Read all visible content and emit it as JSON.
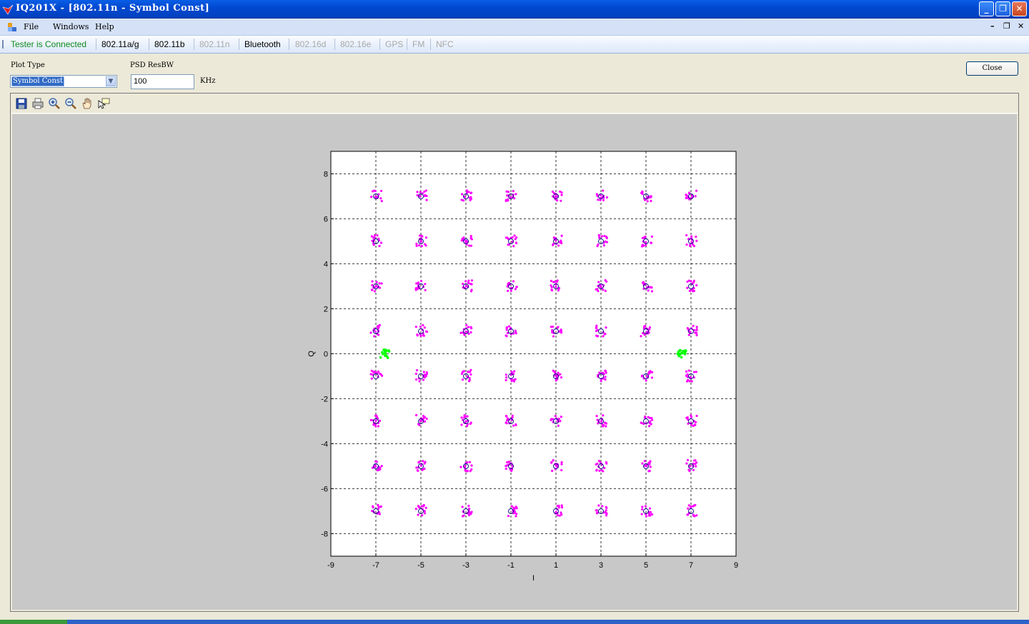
{
  "window": {
    "title": "IQ201X - [802.11n - Symbol Const]",
    "buttons": {
      "minimize": "_",
      "restore": "❐",
      "close": "✕"
    }
  },
  "menu": {
    "items": [
      "File",
      "Windows",
      "Help"
    ],
    "mdi": {
      "minimize": "–",
      "restore": "❐",
      "close": "✕"
    }
  },
  "tabs": [
    {
      "label": "Tester is Connected",
      "state": "status"
    },
    {
      "label": "802.11a/g",
      "state": "enabled"
    },
    {
      "label": "802.11b",
      "state": "enabled"
    },
    {
      "label": "802.11n",
      "state": "disabled"
    },
    {
      "label": "Bluetooth",
      "state": "enabled"
    },
    {
      "label": "802.16d",
      "state": "disabled"
    },
    {
      "label": "802.16e",
      "state": "disabled"
    },
    {
      "label": "GPS",
      "state": "disabled"
    },
    {
      "label": "FM",
      "state": "disabled"
    },
    {
      "label": "NFC",
      "state": "disabled"
    }
  ],
  "controls": {
    "plot_type_label": "Plot Type",
    "plot_type_value": "Symbol Const",
    "psd_label": "PSD ResBW",
    "psd_value": "100",
    "psd_unit": "KHz",
    "close_label": "Close"
  },
  "toolbar_icons": [
    "save-icon",
    "print-icon",
    "zoom-in-icon",
    "zoom-out-icon",
    "pan-hand-icon",
    "data-cursor-icon"
  ],
  "colors": {
    "data_points": "#ff00ff",
    "pilots": "#00ff00",
    "ideal_markers": "#000080"
  },
  "chart_data": {
    "type": "scatter",
    "xlabel": "I",
    "ylabel": "Q",
    "xlim": [
      -9,
      9
    ],
    "ylim": [
      -9,
      9
    ],
    "xticks": [
      -9,
      -7,
      -5,
      -3,
      -1,
      1,
      3,
      5,
      7,
      9
    ],
    "yticks": [
      -8,
      -6,
      -4,
      -2,
      0,
      2,
      4,
      6,
      8
    ],
    "grid": true,
    "constellation": "64-QAM",
    "ideal_points": {
      "i": [
        -7,
        -5,
        -3,
        -1,
        1,
        3,
        5,
        7
      ],
      "q": [
        -7,
        -5,
        -3,
        -1,
        1,
        3,
        5,
        7
      ]
    },
    "pilot_points": [
      [
        -6.6,
        0
      ],
      [
        6.6,
        0
      ]
    ]
  }
}
